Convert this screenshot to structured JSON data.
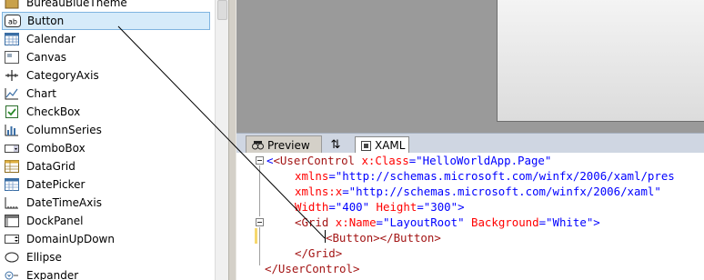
{
  "toolbox": {
    "items": [
      {
        "label": "BureauBlueTheme",
        "icon": "theme-icon"
      },
      {
        "label": "Button",
        "icon": "button-icon"
      },
      {
        "label": "Calendar",
        "icon": "calendar-icon"
      },
      {
        "label": "Canvas",
        "icon": "canvas-icon"
      },
      {
        "label": "CategoryAxis",
        "icon": "category-axis-icon"
      },
      {
        "label": "Chart",
        "icon": "chart-icon"
      },
      {
        "label": "CheckBox",
        "icon": "checkbox-icon"
      },
      {
        "label": "ColumnSeries",
        "icon": "column-series-icon"
      },
      {
        "label": "ComboBox",
        "icon": "combobox-icon"
      },
      {
        "label": "DataGrid",
        "icon": "datagrid-icon"
      },
      {
        "label": "DatePicker",
        "icon": "datepicker-icon"
      },
      {
        "label": "DateTimeAxis",
        "icon": "datetime-axis-icon"
      },
      {
        "label": "DockPanel",
        "icon": "dockpanel-icon"
      },
      {
        "label": "DomainUpDown",
        "icon": "domain-updown-icon"
      },
      {
        "label": "Ellipse",
        "icon": "ellipse-icon"
      },
      {
        "label": "Expander",
        "icon": "expander-icon"
      }
    ],
    "selected": "Button"
  },
  "tabs": {
    "preview": "Preview",
    "swap": "⇅",
    "xaml": "XAML"
  },
  "code": {
    "l1": {
      "t1": "<UserControl",
      "a1": " x:Class",
      "p1": "=\"",
      "v1": "HelloWorldApp.Page",
      "p2": "\""
    },
    "l2": {
      "a1": "xmlns",
      "p1": "=\"",
      "v1": "http://schemas.microsoft.com/winfx/2006/xaml/pres"
    },
    "l3": {
      "a1": "xmlns:x",
      "p1": "=\"",
      "v1": "http://schemas.microsoft.com/winfx/2006/xaml",
      "p2": "\""
    },
    "l4": {
      "a1": "Width",
      "p1": "=\"",
      "v1": "400",
      "p2": "\"",
      "a2": " Height",
      "p3": "=\"",
      "v2": "300",
      "p4": "\">"
    },
    "l5": {
      "t1": "<Grid",
      "a1": " x:Name",
      "p1": "=\"",
      "v1": "LayoutRoot",
      "p2": "\"",
      "a2": " Background",
      "p3": "=\"",
      "v2": "White",
      "p4": "\">"
    },
    "l6": {
      "t1": "<Button></Button>"
    },
    "l7": {
      "t1": "</Grid>"
    },
    "l8": {
      "t1": "</UserControl>"
    }
  }
}
